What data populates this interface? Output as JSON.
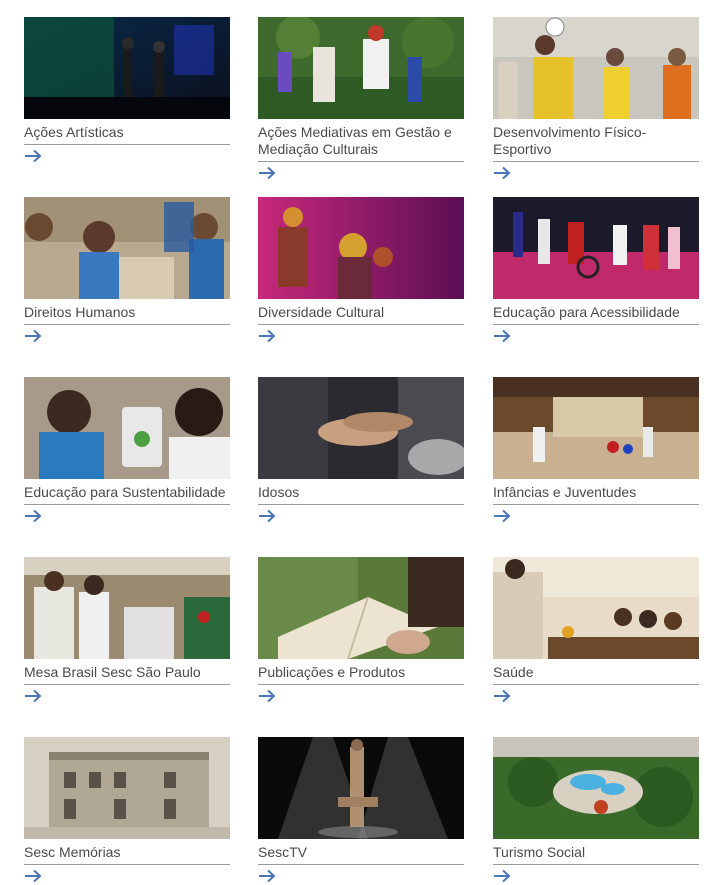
{
  "accent_color": "#4a76b5",
  "arrow_icon": "arrow-right-icon",
  "cards": [
    {
      "label": "Ações Artísticas",
      "image": "concert-stage-photo"
    },
    {
      "label": "Ações Mediativas em Gestão e Mediação Culturais",
      "image": "garden-workshop-photo"
    },
    {
      "label": "Desenvolvimento Físico-Esportivo",
      "image": "volleyball-game-photo"
    },
    {
      "label": "Direitos Humanos",
      "image": "children-classroom-photo"
    },
    {
      "label": "Diversidade Cultural",
      "image": "costumed-performers-photo"
    },
    {
      "label": "Educação para Acessibilidade",
      "image": "inclusive-dance-photo"
    },
    {
      "label": "Educação para Sustentabilidade",
      "image": "children-tablet-photo"
    },
    {
      "label": "Idosos",
      "image": "holding-hands-photo"
    },
    {
      "label": "Infâncias e Juventudes",
      "image": "indoor-activity-hall-photo"
    },
    {
      "label": "Mesa Brasil Sesc São Paulo",
      "image": "food-market-photo"
    },
    {
      "label": "Publicações e Produtos",
      "image": "reading-book-photo"
    },
    {
      "label": "Saúde",
      "image": "cooking-class-photo"
    },
    {
      "label": "Sesc Memórias",
      "image": "historic-building-photo"
    },
    {
      "label": "SescTV",
      "image": "acrobats-spotlight-photo"
    },
    {
      "label": "Turismo Social",
      "image": "resort-aerial-photo"
    }
  ]
}
